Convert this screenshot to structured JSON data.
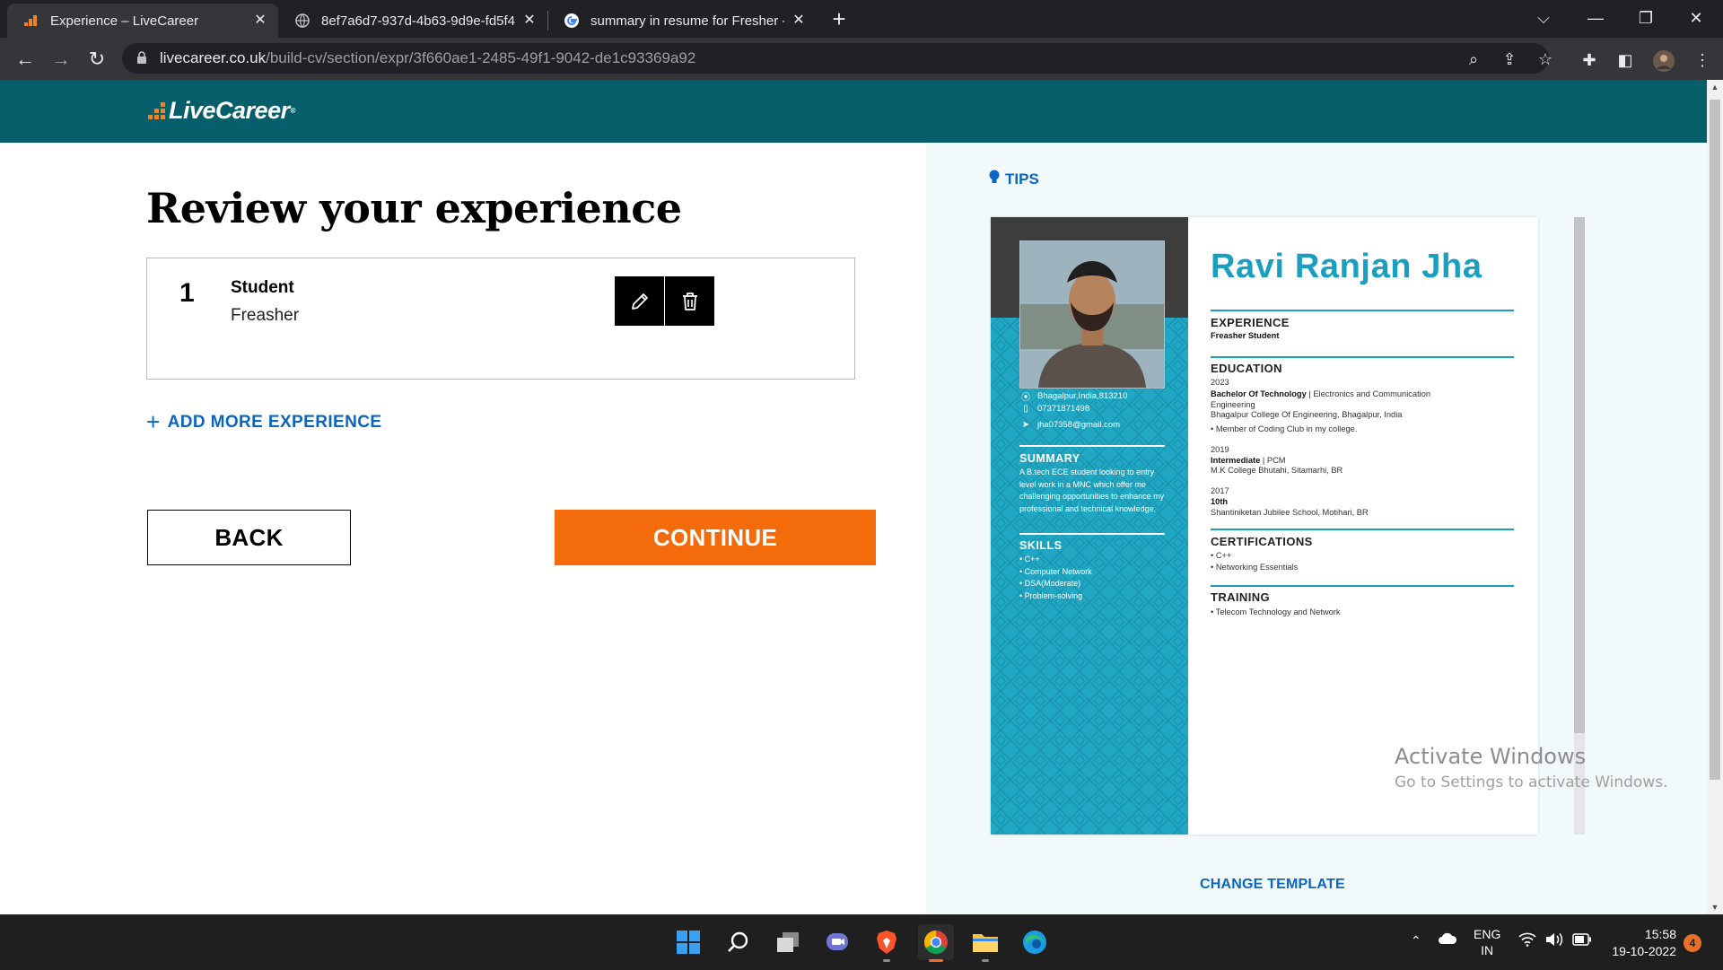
{
  "browser": {
    "tabs": [
      {
        "title": "Experience – LiveCareer",
        "active": true,
        "icon": "livecareer-favicon"
      },
      {
        "title": "8ef7a6d7-937d-4b63-9d9e-fd5f4",
        "active": false,
        "icon": "globe-icon"
      },
      {
        "title": "summary in resume for Fresher -",
        "active": false,
        "icon": "google-icon"
      }
    ],
    "url_host": "livecareer.co.uk",
    "url_path": "/build-cv/section/expr/3f660ae1-2485-49f1-9042-de1c93369a92"
  },
  "site": {
    "logo_text": "LiveCareer",
    "logo_mark": "®"
  },
  "experience_page": {
    "heading": "Review your experience",
    "items": [
      {
        "number": "1",
        "title": "Student",
        "subtitle": "Freasher"
      }
    ],
    "add_more_label": "ADD MORE EXPERIENCE",
    "back_label": "BACK",
    "continue_label": "CONTINUE"
  },
  "preview": {
    "tips_label": "TIPS",
    "change_template_label": "CHANGE TEMPLATE",
    "resume": {
      "name": "Ravi Ranjan Jha",
      "contact": {
        "location": "Bhagalpur,India,813210",
        "phone": "07371871498",
        "email": "jha07358@gmail.com"
      },
      "summary_heading": "SUMMARY",
      "summary_text": "A B.tech ECE student looking to entry level work in a MNC which offer me challenging opportunities to enhance my professional and technical knowledge.",
      "skills_heading": "SKILLS",
      "skills": [
        "C++",
        "Computer Network",
        "DSA(Moderate)",
        "Problem-solving"
      ],
      "experience_heading": "EXPERIENCE",
      "experience_text": "Freasher Student",
      "education_heading": "EDUCATION",
      "education": [
        {
          "year": "2023",
          "degree": "Bachelor Of Technology",
          "field": " | Electronics and Communication",
          "field_cont": "Engineering",
          "school": "Bhagalpur College Of Engineering, Bhagalpur, India",
          "note": "• Member of Coding Club in my college."
        },
        {
          "year": "2019",
          "degree": "Intermediate",
          "field": " | PCM",
          "school": "M.K College Bhutahi, Sitamarhi, BR"
        },
        {
          "year": "2017",
          "degree": "10th",
          "school": "Shantiniketan Jubilee School, Motihari, BR"
        }
      ],
      "certifications_heading": "CERTIFICATIONS",
      "certifications": [
        "• C++",
        "• Networking Essentials"
      ],
      "training_heading": "TRAINING",
      "training": [
        "• Telecom Technology and Network"
      ]
    }
  },
  "watermark": {
    "line1": "Activate Windows",
    "line2": "Go to Settings to activate Windows."
  },
  "taskbar": {
    "lang1": "ENG",
    "lang2": "IN",
    "time": "15:58",
    "date": "19-10-2022",
    "notification_count": "4"
  },
  "colors": {
    "header_teal": "#065e6b",
    "accent_orange": "#f36b0a",
    "link_blue": "#0a66c2",
    "resume_cyan": "#1fa7c4"
  }
}
